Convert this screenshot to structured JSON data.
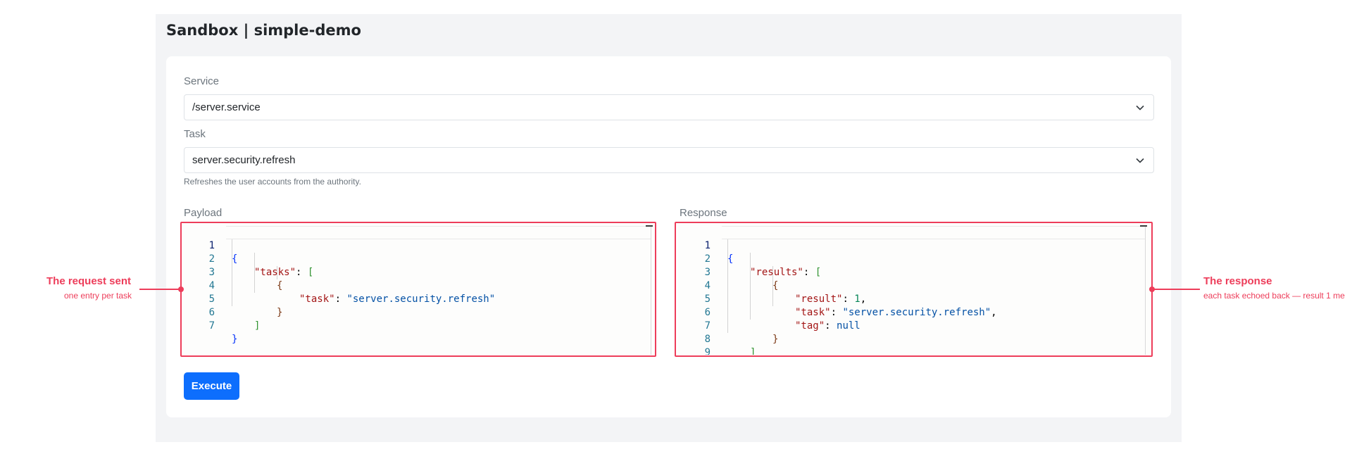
{
  "header": {
    "title": "Sandbox | simple-demo"
  },
  "form": {
    "service": {
      "label": "Service",
      "value": "/server.service"
    },
    "task": {
      "label": "Task",
      "value": "server.security.refresh"
    },
    "task_help": "Refreshes the user accounts from the authority.",
    "payload_label": "Payload",
    "response_label": "Response",
    "execute_label": "Execute"
  },
  "payload_editor": {
    "line_numbers": [
      "1",
      "2",
      "3",
      "4",
      "5",
      "6",
      "7"
    ],
    "tokens": {
      "open_brace": "{",
      "tasks_key": "\"tasks\"",
      "colon_sp": ": ",
      "open_bracket": "[",
      "inner_open": "{",
      "task_key": "\"task\"",
      "task_value": "\"server.security.refresh\"",
      "inner_close": "}",
      "close_bracket": "]",
      "close_brace": "}"
    }
  },
  "response_editor": {
    "line_numbers": [
      "1",
      "2",
      "3",
      "4",
      "5",
      "6",
      "7",
      "8",
      "9"
    ],
    "tokens": {
      "open_brace": "{",
      "results_key": "\"results\"",
      "colon_sp": ": ",
      "open_bracket": "[",
      "inner_open": "{",
      "result_key": "\"result\"",
      "result_value": "1",
      "comma": ",",
      "task_key": "\"task\"",
      "task_value": "\"server.security.refresh\"",
      "tag_key": "\"tag\"",
      "tag_value": "null",
      "inner_close": "}",
      "close_bracket": "]",
      "close_brace": "}"
    }
  },
  "annotations": {
    "request": {
      "title": "The request sent",
      "subtitle": "one entry per task"
    },
    "response": {
      "title": "The response",
      "subtitle": "each task echoed back — result 1 me"
    }
  },
  "colors": {
    "highlight": "#ed3d5a",
    "primary_button": "#0d6efd"
  },
  "icons": {
    "select_chevron": "chevron-down-icon"
  }
}
